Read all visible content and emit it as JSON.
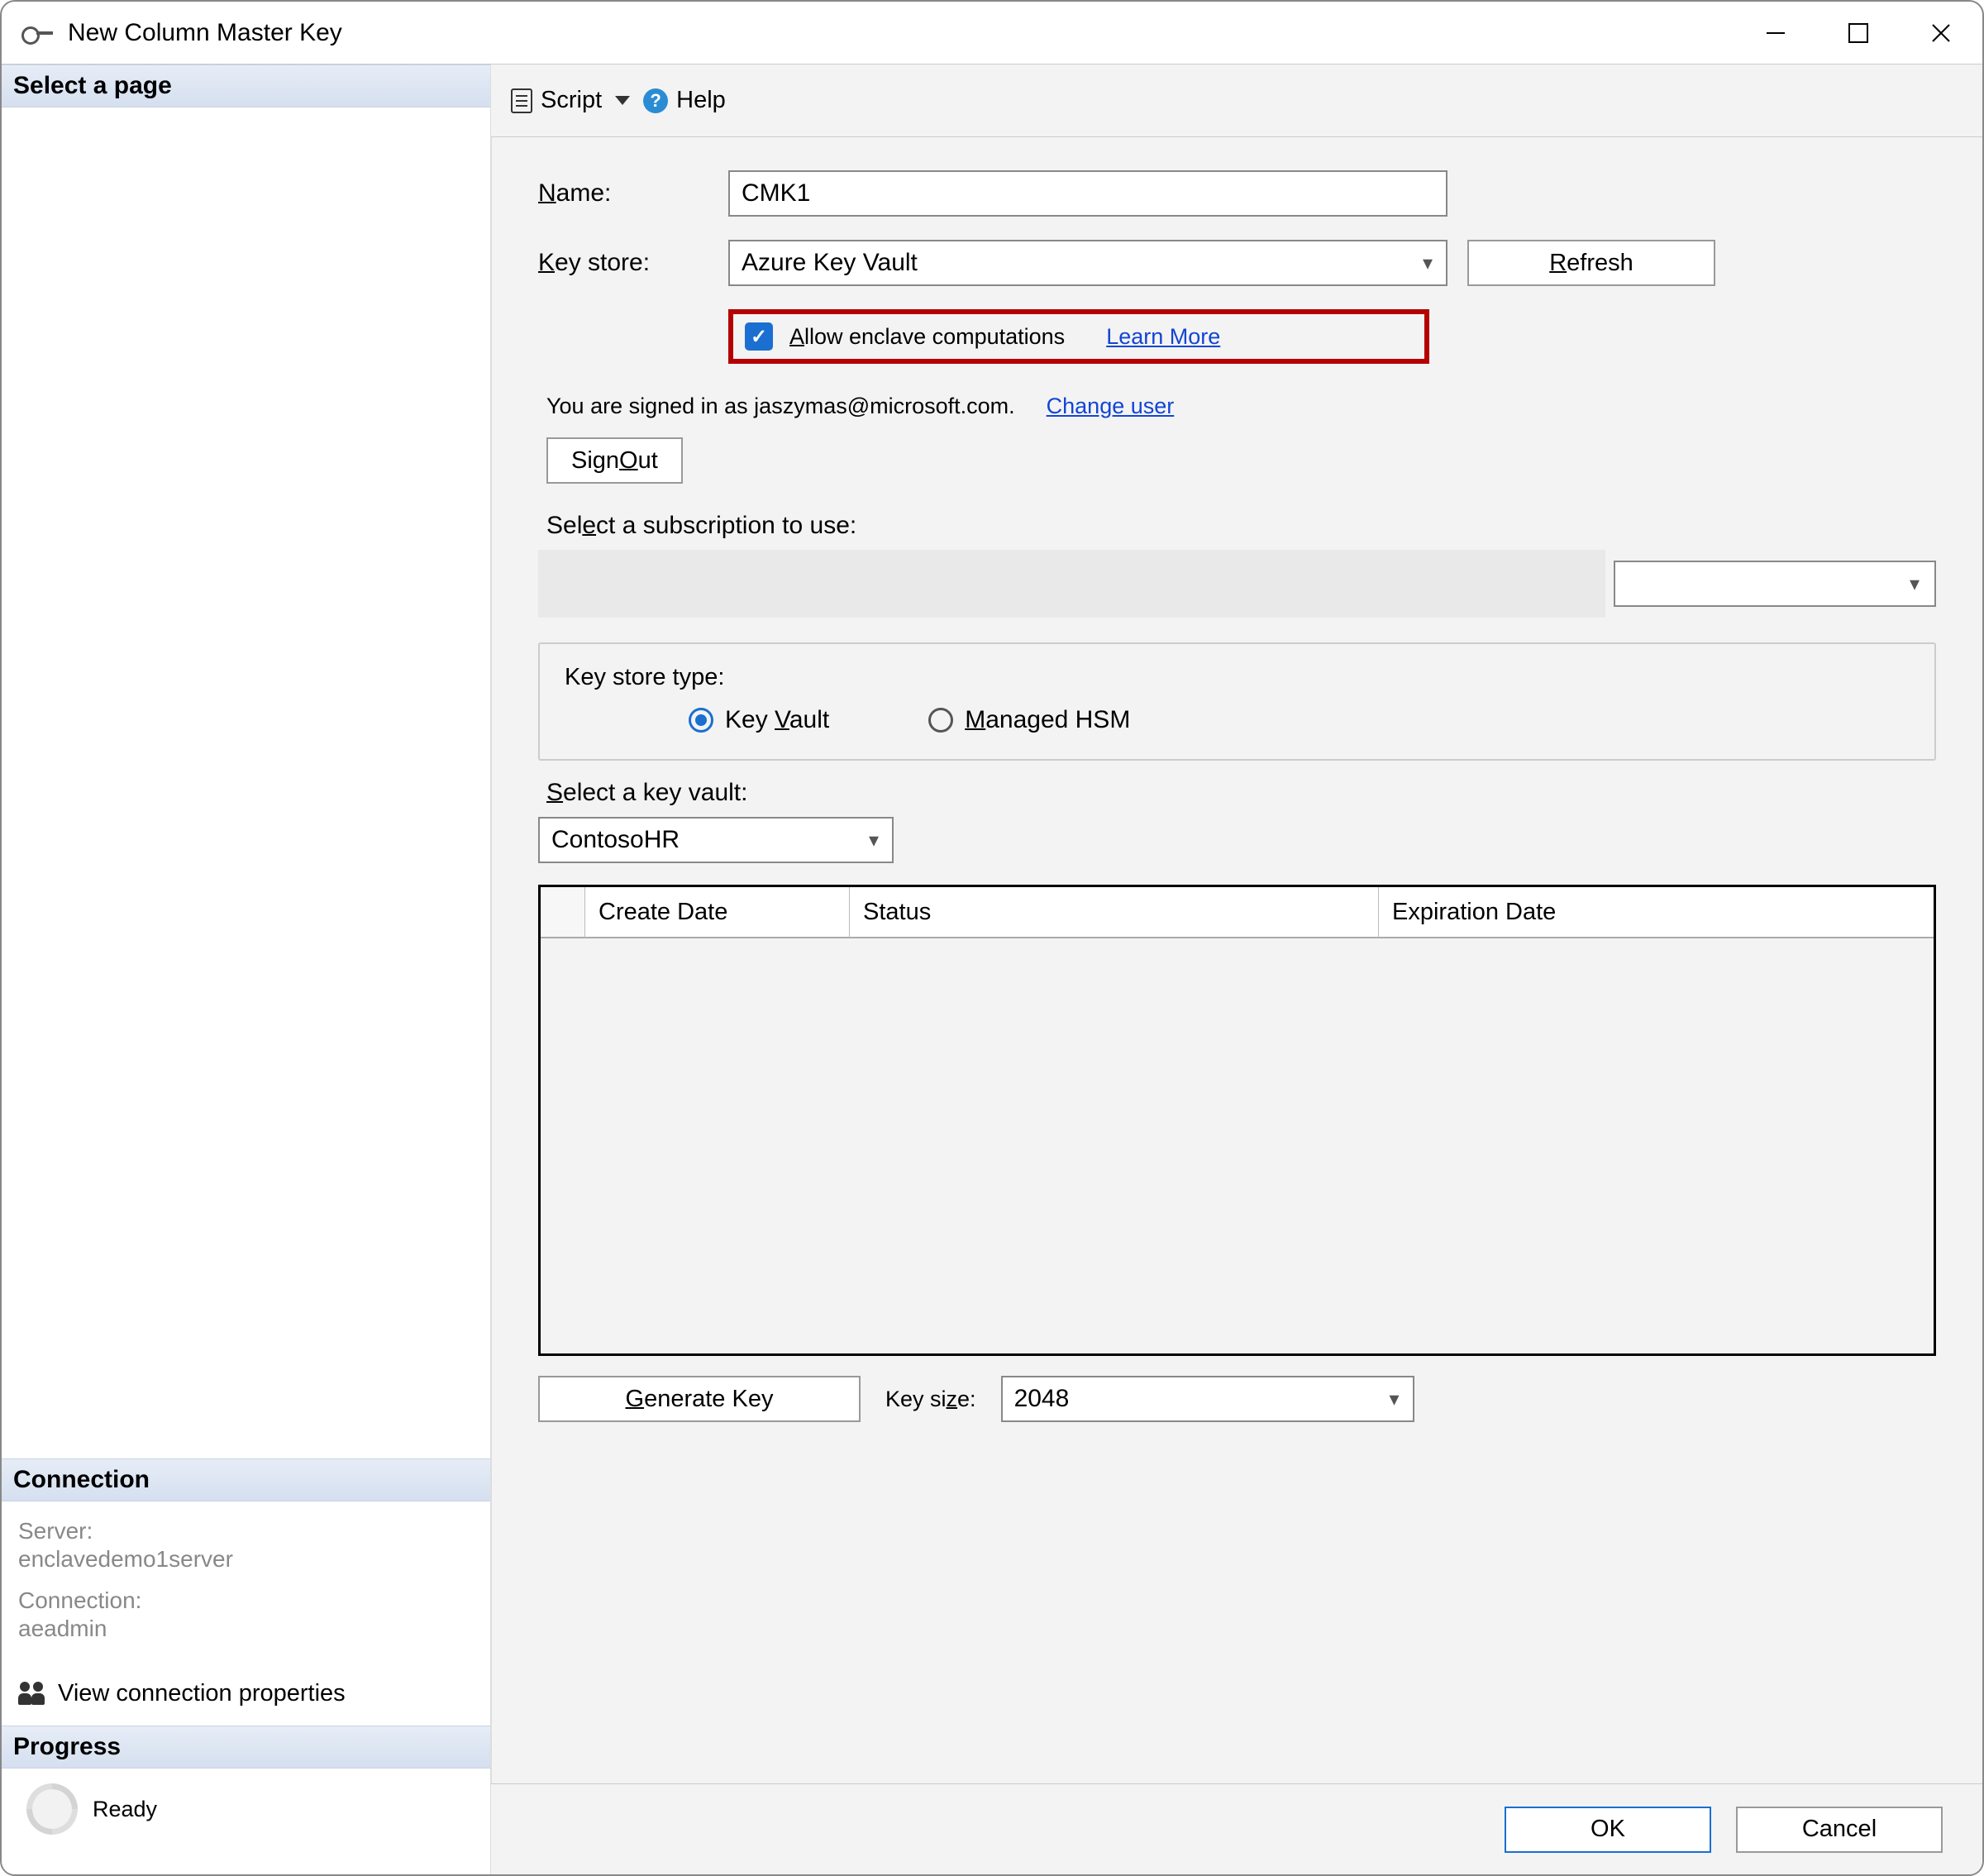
{
  "window": {
    "title": "New Column Master Key"
  },
  "left": {
    "select_page": "Select a page",
    "connection_header": "Connection",
    "server_label": "Server:",
    "server_value": "enclavedemo1server",
    "connection_label": "Connection:",
    "connection_value": "aeadmin",
    "view_conn": "View connection properties",
    "progress_header": "Progress",
    "progress_status": "Ready"
  },
  "toolbar": {
    "script": "Script",
    "help": "Help"
  },
  "form": {
    "name_label": "Name:",
    "name_underline": "N",
    "name_value": "CMK1",
    "keystore_label": "ey store:",
    "keystore_underline": "K",
    "keystore_value": "Azure Key Vault",
    "refresh": "efresh",
    "refresh_underline": "R",
    "allow_enclave": "llow enclave computations",
    "allow_enclave_underline": "A",
    "learn_more": "Learn More",
    "signed_in": "You are signed in as jaszymas@microsoft.com.",
    "change_user": "Change user",
    "sign_out": "Sign ",
    "sign_out_underline": "O",
    "sign_out_suffix": "ut",
    "select_sub": "Sel",
    "select_sub_underline": "e",
    "select_sub_suffix": "ct a subscription to use:",
    "keystore_type_label": "Key store type:",
    "radio_keyvault": "Key ",
    "radio_keyvault_underline": "V",
    "radio_keyvault_suffix": "ault",
    "radio_mhsm_underline": "M",
    "radio_mhsm_suffix": "anaged HSM",
    "select_kv_underline": "S",
    "select_kv_suffix": "elect a key vault:",
    "kv_value": "ContosoHR",
    "grid": {
      "c1": "Create Date",
      "c2": "Status",
      "c3": "Expiration Date"
    },
    "gen_key_underline": "G",
    "gen_key_suffix": "enerate Key",
    "keysize_label": "Key si",
    "keysize_underline": "z",
    "keysize_suffix": "e:",
    "keysize_value": "2048"
  },
  "footer": {
    "ok": "OK",
    "cancel": "Cancel"
  }
}
